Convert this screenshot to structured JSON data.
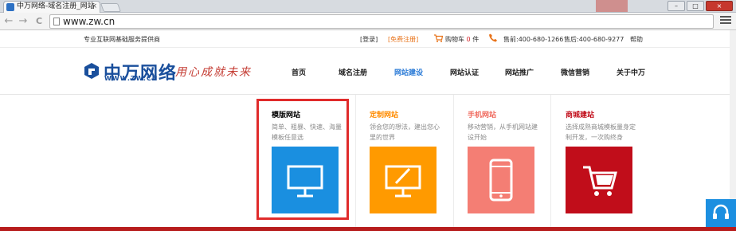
{
  "browser": {
    "tab_title": "中万网络-域名注册_网站",
    "tab_close": "×",
    "url": "www.zw.cn",
    "nav_back": "←",
    "nav_forward": "→",
    "nav_reload": "C",
    "window_minimize": "–",
    "window_maximize": "□",
    "window_close": "×"
  },
  "topbar": {
    "tagline": "专业互联网基础服务提供商",
    "login": "[登录]",
    "register": "[免费注册]",
    "cart_label": "购物车",
    "cart_count": "0",
    "cart_unit": "件",
    "presale": "售前:400-680-1266",
    "aftersale": "售后:400-680-9277",
    "help": "帮助"
  },
  "header": {
    "logo_cn": "中万网络",
    "logo_en": "WWW.ZW.CN",
    "slogan": "用心成就未来"
  },
  "nav": {
    "items": [
      "首页",
      "域名注册",
      "网站建设",
      "网站认证",
      "网站推广",
      "微信营销",
      "关于中万"
    ]
  },
  "dropdown": {
    "cards": [
      {
        "title": "模版网站",
        "desc": "简单、粗暴、快速、海量模板任意选",
        "color": "#1a8fe0",
        "title_color": "#1a8fe0"
      },
      {
        "title": "定制网站",
        "desc": "领会您的想法，建出您心里的世界",
        "color": "#ff9a00",
        "title_color": "#ff8c00"
      },
      {
        "title": "手机网站",
        "desc": "移动营销，从手机网站建设开始",
        "color": "#f47e74",
        "title_color": "#f06b5f"
      },
      {
        "title": "商城建站",
        "desc": "选择成熟商城模板量身定制开发，一次购终身",
        "color": "#c10d1a",
        "title_color": "#c10d1a"
      }
    ]
  }
}
